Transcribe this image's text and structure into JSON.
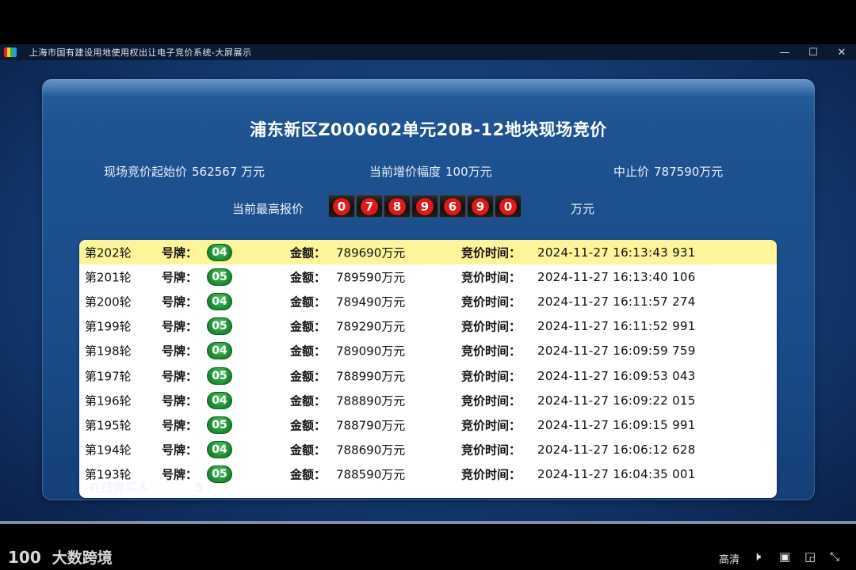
{
  "window": {
    "title": "上海市国有建设用地使用权出让电子竞价系统-大屏展示",
    "minimize_icon": "—",
    "maximize_icon": "☐",
    "close_icon": "✕"
  },
  "auction": {
    "title": "浦东新区Z000602单元20B-12地块现场竞价",
    "start_price_label": "现场竞价起始价",
    "start_price_value": "562567 万元",
    "increment_label": "当前增价幅度",
    "increment_value": "100万元",
    "stop_price_label": "中止价",
    "stop_price_value": "787590万元",
    "highest_bid_label": "当前最高报价",
    "highest_bid_digits": [
      "0",
      "7",
      "8",
      "9",
      "6",
      "9",
      "0"
    ],
    "highest_bid_unit": "万元"
  },
  "table": {
    "plate_label": "号牌：",
    "amount_label": "金额：",
    "time_label": "竞价时间：",
    "rows": [
      {
        "round": "第202轮",
        "plate": "04",
        "amount": "789690万元",
        "time": "2024-11-27 16:13:43 931"
      },
      {
        "round": "第201轮",
        "plate": "05",
        "amount": "789590万元",
        "time": "2024-11-27 16:13:40 106"
      },
      {
        "round": "第200轮",
        "plate": "04",
        "amount": "789490万元",
        "time": "2024-11-27 16:11:57 274"
      },
      {
        "round": "第199轮",
        "plate": "05",
        "amount": "789290万元",
        "time": "2024-11-27 16:11:52 991"
      },
      {
        "round": "第198轮",
        "plate": "04",
        "amount": "789090万元",
        "time": "2024-11-27 16:09:59 759"
      },
      {
        "round": "第197轮",
        "plate": "05",
        "amount": "788990万元",
        "time": "2024-11-27 16:09:53 043"
      },
      {
        "round": "第196轮",
        "plate": "04",
        "amount": "788890万元",
        "time": "2024-11-27 16:09:22 015"
      },
      {
        "round": "第195轮",
        "plate": "05",
        "amount": "788790万元",
        "time": "2024-11-27 16:09:15 991"
      },
      {
        "round": "第194轮",
        "plate": "04",
        "amount": "788690万元",
        "time": "2024-11-27 16:06:12 628"
      },
      {
        "round": "第193轮",
        "plate": "05",
        "amount": "788590万元",
        "time": "2024-11-27 16:04:35 001"
      }
    ]
  },
  "online": {
    "label": "在线竞买人：",
    "count": "5"
  },
  "player": {
    "logo_mark": "100",
    "logo_text": "大数跨境",
    "quality": "高清",
    "volume_icon": "🕨",
    "danmaku_icon": "▣",
    "pip_icon": "◲",
    "exit_fullscreen_icon": "⤡"
  }
}
